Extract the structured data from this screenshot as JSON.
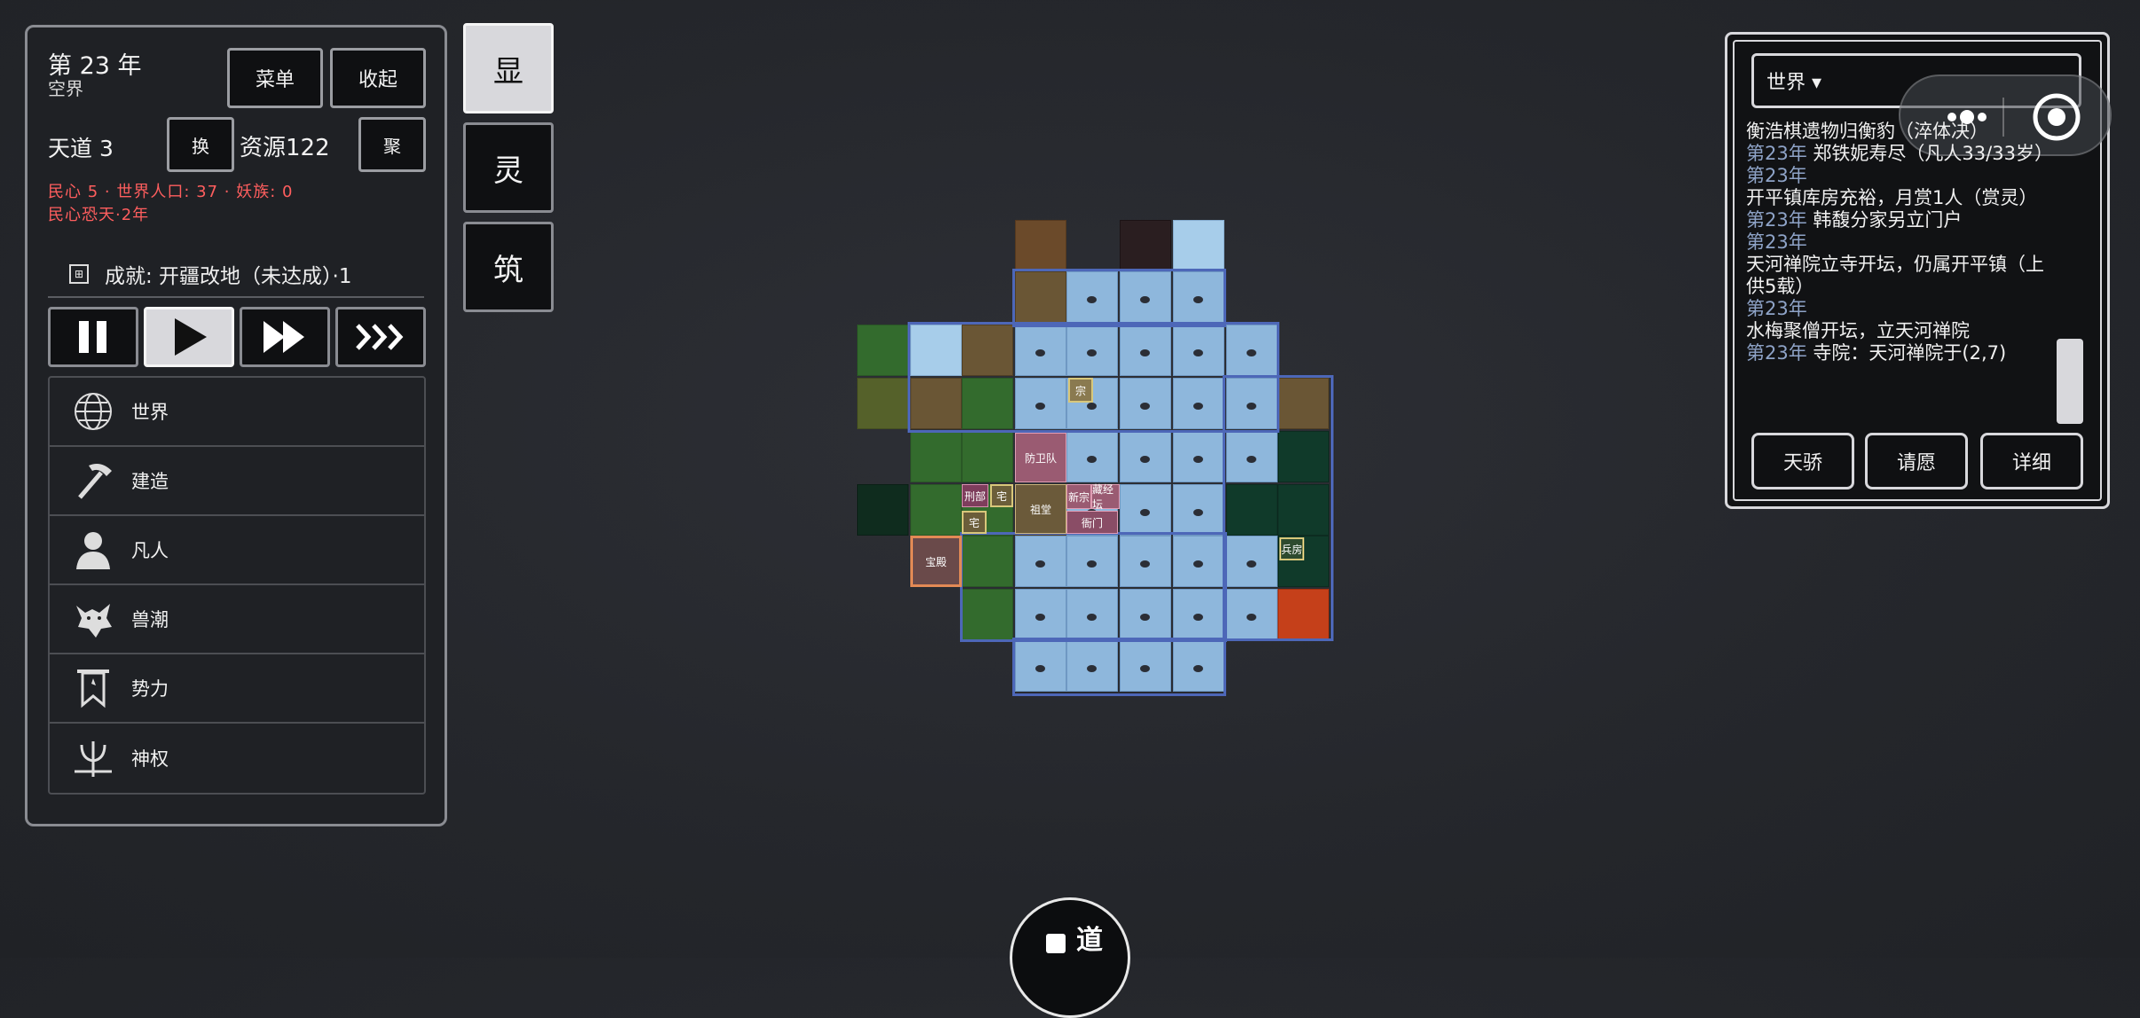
{
  "status": {
    "year": "第 23 年",
    "realm": "空界",
    "tiandao": "天道 3",
    "resource": "资源122",
    "warning_line1": "民心 5 · 世界人口: 37 · 妖族: 0",
    "warning_line2": "民心恐天·2年",
    "achievement": "成就: 开疆改地（未达成）·1"
  },
  "buttons": {
    "menu": "菜单",
    "collapse": "收起",
    "swap": "换",
    "gather": "聚"
  },
  "speed_controls": [
    "pause",
    "play",
    "fast",
    "fastest"
  ],
  "speed_active": "play",
  "menu": [
    {
      "label": "世界",
      "icon": "globe-icon"
    },
    {
      "label": "建造",
      "icon": "hammer-icon"
    },
    {
      "label": "凡人",
      "icon": "person-icon"
    },
    {
      "label": "兽潮",
      "icon": "wolf-icon"
    },
    {
      "label": "势力",
      "icon": "banner-icon"
    },
    {
      "label": "神权",
      "icon": "trident-icon"
    }
  ],
  "side_tabs": [
    "显",
    "灵",
    "筑"
  ],
  "side_tab_active": "显",
  "map": {
    "buildings": {
      "b1": "宗",
      "b2": "防卫队",
      "b3": "刑部",
      "b4": "宅",
      "b5": "宅",
      "b6": "祖堂",
      "b7": "新宗",
      "b8": "藏经坛",
      "b9": "衙门",
      "b10": "宝殿",
      "b11": "兵房"
    }
  },
  "log": {
    "filter": "世界 ▾",
    "entries": [
      {
        "year": "",
        "text": "衡浩棋遗物归衡豹（淬体决）"
      },
      {
        "year": "第23年",
        "text": "郑铁妮寿尽（凡人33/33岁）"
      },
      {
        "year": "第23年",
        "text": ""
      },
      {
        "year": "",
        "text": "开平镇库房充裕，月赏1人（赏灵）"
      },
      {
        "year": "第23年",
        "text": "韩馥分家另立门户"
      },
      {
        "year": "第23年",
        "text": ""
      },
      {
        "year": "",
        "text": "天河禅院立寺开坛，仍属开平镇（上供5载）"
      },
      {
        "year": "第23年",
        "text": ""
      },
      {
        "year": "",
        "text": "水梅聚僧开坛，立天河禅院"
      },
      {
        "year": "第23年",
        "text": "寺院：天河禅院于(2,7)"
      }
    ],
    "buttons": {
      "tianjiao": "天骄",
      "qingyuan": "请愿",
      "xiangxi": "详细"
    }
  },
  "bottom": {
    "dao": "道"
  },
  "colors": {
    "accent": "#4d67b8",
    "warning": "#ff5e5e",
    "log_year": "#8ea3c7"
  }
}
